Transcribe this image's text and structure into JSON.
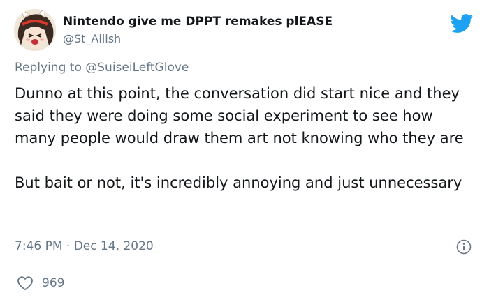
{
  "author": {
    "display_name": "Nintendo give me DPPT remakes plEASE",
    "handle": "@St_Ailish"
  },
  "reply": {
    "prefix": "Replying to ",
    "mention": "@SuiseiLeftGlove"
  },
  "tweet": {
    "paragraphs": [
      "Dunno at this point, the conversation did start nice and they said they were doing some social experiment to see how many people would draw them art not knowing who they are",
      "But bait or not, it's incredibly annoying and just unnecessary"
    ],
    "timestamp": "7:46 PM · Dec 14, 2020"
  },
  "engagement": {
    "likes": "969"
  },
  "icons": {
    "brand": "twitter-bird-icon",
    "info": "info-icon",
    "like": "heart-icon"
  },
  "colors": {
    "twitter_blue": "#1da1f2",
    "secondary_text": "#657786",
    "primary_text": "#14171a",
    "divider": "#e1e8ed"
  }
}
